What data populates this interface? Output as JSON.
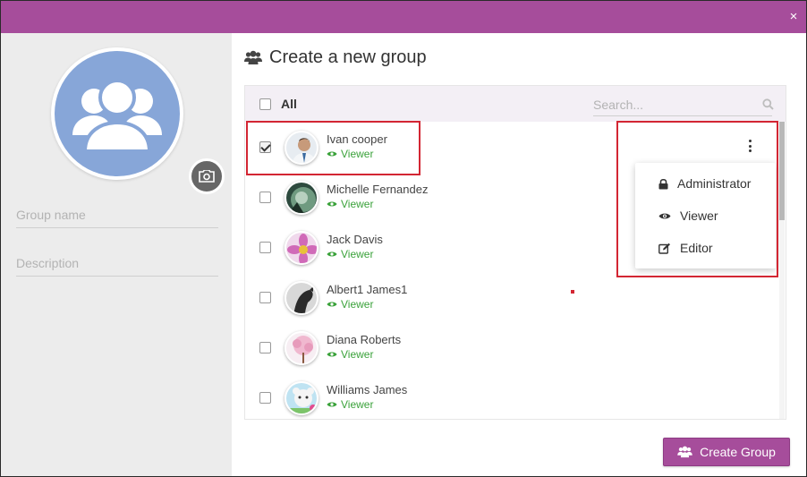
{
  "window": {
    "close_label": "×"
  },
  "colors": {
    "brand": "#a64d9b",
    "avatar_bg": "#87a6d8",
    "role_green": "#3aa23a",
    "highlight_red": "#d32633"
  },
  "left": {
    "group_name_placeholder": "Group name",
    "description_placeholder": "Description"
  },
  "header": {
    "title": "Create a new group"
  },
  "list": {
    "all_label": "All",
    "search_placeholder": "Search...",
    "members": [
      {
        "name": "Ivan cooper",
        "role": "Viewer",
        "checked": true
      },
      {
        "name": "Michelle Fernandez",
        "role": "Viewer",
        "checked": false
      },
      {
        "name": "Jack Davis",
        "role": "Viewer",
        "checked": false
      },
      {
        "name": "Albert1 James1",
        "role": "Viewer",
        "checked": false
      },
      {
        "name": "Diana Roberts",
        "role": "Viewer",
        "checked": false
      },
      {
        "name": "Williams James",
        "role": "Viewer",
        "checked": false
      }
    ]
  },
  "role_menu": {
    "items": [
      {
        "label": "Administrator",
        "icon": "lock-icon"
      },
      {
        "label": "Viewer",
        "icon": "eye-icon"
      },
      {
        "label": "Editor",
        "icon": "edit-icon"
      }
    ]
  },
  "footer": {
    "create_label": "Create Group"
  }
}
